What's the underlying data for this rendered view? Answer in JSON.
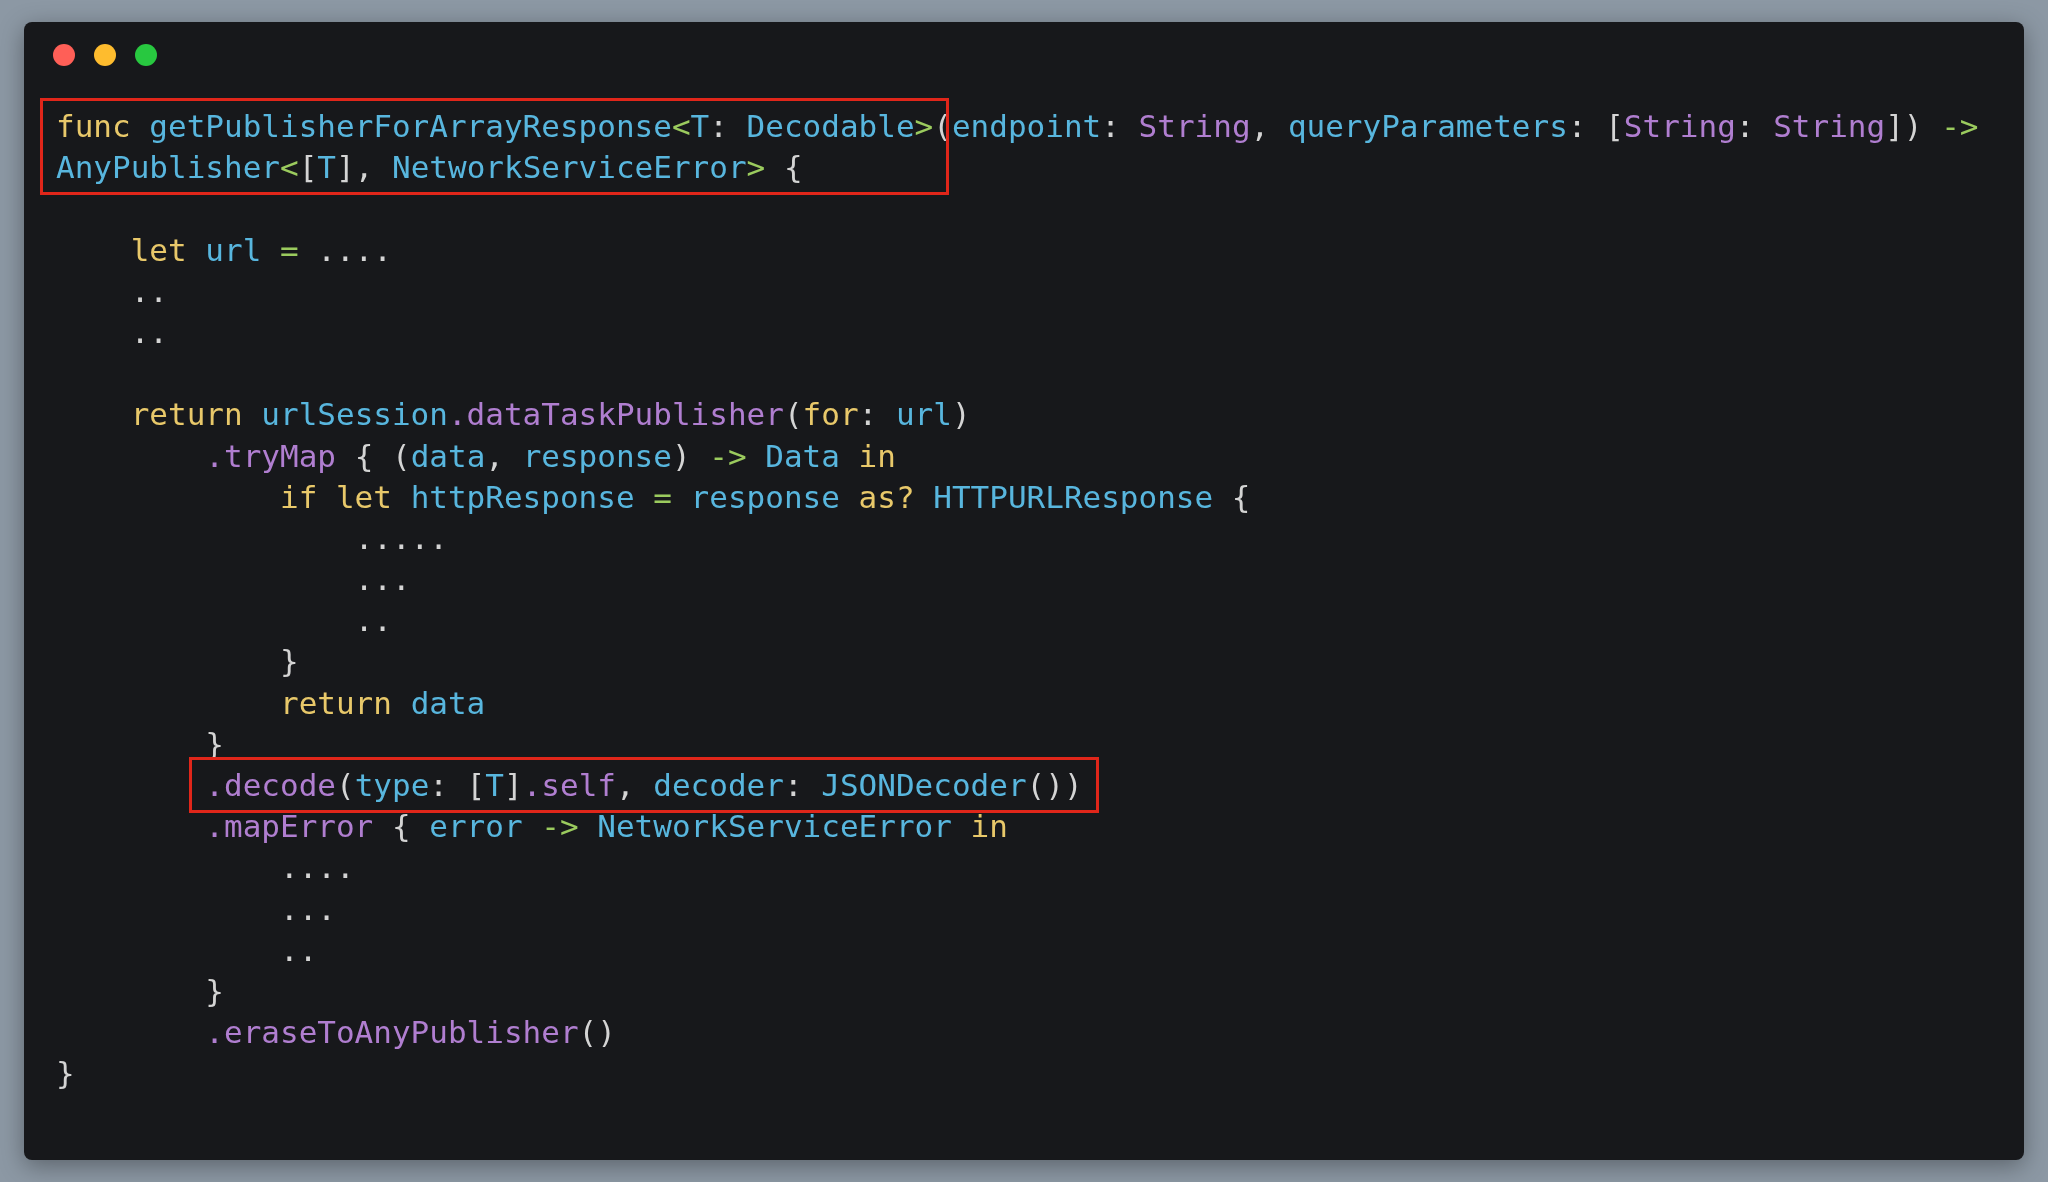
{
  "window": {
    "controls": [
      {
        "color": "#ff5f57"
      },
      {
        "color": "#febc2e"
      },
      {
        "color": "#28c840"
      }
    ]
  },
  "lines": [
    {
      "kind": "code",
      "segments": [
        {
          "highlighted": true,
          "tokens": [
            {
              "text": "func ",
              "kind": "keyword"
            },
            {
              "text": "getPublisherForArrayResponse",
              "kind": "identifier"
            },
            {
              "text": "<",
              "kind": "operator"
            },
            {
              "text": "T",
              "kind": "identifier"
            },
            {
              "text": ": ",
              "kind": "plain"
            },
            {
              "text": "Decodable",
              "kind": "identifier"
            },
            {
              "text": ">",
              "kind": "operator"
            }
          ]
        },
        {
          "highlighted": false,
          "tokens": [
            {
              "text": "(",
              "kind": "plain"
            },
            {
              "text": "endpoint",
              "kind": "identifier"
            },
            {
              "text": ": ",
              "kind": "plain"
            },
            {
              "text": "String",
              "kind": "type"
            },
            {
              "text": ", ",
              "kind": "plain"
            },
            {
              "text": "queryParameters",
              "kind": "identifier"
            },
            {
              "text": ": [",
              "kind": "plain"
            },
            {
              "text": "String",
              "kind": "type"
            },
            {
              "text": ": ",
              "kind": "plain"
            },
            {
              "text": "String",
              "kind": "type"
            },
            {
              "text": "]) ",
              "kind": "plain"
            },
            {
              "text": "->",
              "kind": "operator"
            }
          ]
        }
      ]
    },
    {
      "kind": "code",
      "segments": [
        {
          "highlighted": true,
          "tokens": [
            {
              "text": "AnyPublisher",
              "kind": "identifier"
            },
            {
              "text": "<",
              "kind": "operator"
            },
            {
              "text": "[",
              "kind": "plain"
            },
            {
              "text": "T",
              "kind": "identifier"
            },
            {
              "text": "], ",
              "kind": "plain"
            },
            {
              "text": "NetworkServiceError",
              "kind": "identifier"
            },
            {
              "text": ">",
              "kind": "operator"
            },
            {
              "text": " {",
              "kind": "plain"
            }
          ]
        }
      ]
    },
    {
      "kind": "blank"
    },
    {
      "kind": "code",
      "segments": [
        {
          "highlighted": false,
          "tokens": [
            {
              "text": "    let ",
              "kind": "keyword"
            },
            {
              "text": "url ",
              "kind": "identifier"
            },
            {
              "text": "= ",
              "kind": "operator"
            },
            {
              "text": "....",
              "kind": "plain"
            }
          ]
        }
      ]
    },
    {
      "kind": "code",
      "segments": [
        {
          "highlighted": false,
          "tokens": [
            {
              "text": "    ..",
              "kind": "plain"
            }
          ]
        }
      ]
    },
    {
      "kind": "code",
      "segments": [
        {
          "highlighted": false,
          "tokens": [
            {
              "text": "    ..",
              "kind": "plain"
            }
          ]
        }
      ]
    },
    {
      "kind": "blank"
    },
    {
      "kind": "code",
      "segments": [
        {
          "highlighted": false,
          "tokens": [
            {
              "text": "    return ",
              "kind": "keyword"
            },
            {
              "text": "urlSession",
              "kind": "identifier"
            },
            {
              "text": ".dataTaskPublisher",
              "kind": "type"
            },
            {
              "text": "(",
              "kind": "plain"
            },
            {
              "text": "for",
              "kind": "keyword"
            },
            {
              "text": ": ",
              "kind": "plain"
            },
            {
              "text": "url",
              "kind": "identifier"
            },
            {
              "text": ")",
              "kind": "plain"
            }
          ]
        }
      ]
    },
    {
      "kind": "code",
      "segments": [
        {
          "highlighted": false,
          "tokens": [
            {
              "text": "        .tryMap",
              "kind": "type"
            },
            {
              "text": " { (",
              "kind": "plain"
            },
            {
              "text": "data",
              "kind": "identifier"
            },
            {
              "text": ", ",
              "kind": "plain"
            },
            {
              "text": "response",
              "kind": "identifier"
            },
            {
              "text": ") ",
              "kind": "plain"
            },
            {
              "text": "-> ",
              "kind": "operator"
            },
            {
              "text": "Data ",
              "kind": "identifier"
            },
            {
              "text": "in",
              "kind": "keyword"
            }
          ]
        }
      ]
    },
    {
      "kind": "code",
      "segments": [
        {
          "highlighted": false,
          "tokens": [
            {
              "text": "            if let ",
              "kind": "keyword"
            },
            {
              "text": "httpResponse ",
              "kind": "identifier"
            },
            {
              "text": "= ",
              "kind": "operator"
            },
            {
              "text": "response ",
              "kind": "identifier"
            },
            {
              "text": "as? ",
              "kind": "keyword"
            },
            {
              "text": "HTTPURLResponse ",
              "kind": "identifier"
            },
            {
              "text": "{",
              "kind": "plain"
            }
          ]
        }
      ]
    },
    {
      "kind": "code",
      "segments": [
        {
          "highlighted": false,
          "tokens": [
            {
              "text": "                .....",
              "kind": "plain"
            }
          ]
        }
      ]
    },
    {
      "kind": "code",
      "segments": [
        {
          "highlighted": false,
          "tokens": [
            {
              "text": "                ...",
              "kind": "plain"
            }
          ]
        }
      ]
    },
    {
      "kind": "code",
      "segments": [
        {
          "highlighted": false,
          "tokens": [
            {
              "text": "                ..",
              "kind": "plain"
            }
          ]
        }
      ]
    },
    {
      "kind": "code",
      "segments": [
        {
          "highlighted": false,
          "tokens": [
            {
              "text": "            }",
              "kind": "plain"
            }
          ]
        }
      ]
    },
    {
      "kind": "code",
      "segments": [
        {
          "highlighted": false,
          "tokens": [
            {
              "text": "            return ",
              "kind": "keyword"
            },
            {
              "text": "data",
              "kind": "identifier"
            }
          ]
        }
      ]
    },
    {
      "kind": "code",
      "segments": [
        {
          "highlighted": false,
          "tokens": [
            {
              "text": "        }",
              "kind": "plain"
            }
          ]
        }
      ]
    },
    {
      "kind": "code",
      "segments": [
        {
          "highlighted": true,
          "tokens": [
            {
              "text": "        .decode",
              "kind": "type"
            },
            {
              "text": "(",
              "kind": "plain"
            },
            {
              "text": "type",
              "kind": "identifier"
            },
            {
              "text": ": [",
              "kind": "plain"
            },
            {
              "text": "T",
              "kind": "identifier"
            },
            {
              "text": "]",
              "kind": "plain"
            },
            {
              "text": ".self",
              "kind": "type"
            },
            {
              "text": ", ",
              "kind": "plain"
            },
            {
              "text": "decoder",
              "kind": "identifier"
            },
            {
              "text": ": ",
              "kind": "plain"
            },
            {
              "text": "JSONDecoder",
              "kind": "identifier"
            },
            {
              "text": "())",
              "kind": "plain"
            }
          ]
        }
      ]
    },
    {
      "kind": "code",
      "segments": [
        {
          "highlighted": false,
          "tokens": [
            {
              "text": "        .mapError",
              "kind": "type"
            },
            {
              "text": " { ",
              "kind": "plain"
            },
            {
              "text": "error ",
              "kind": "identifier"
            },
            {
              "text": "-> ",
              "kind": "operator"
            },
            {
              "text": "NetworkServiceError ",
              "kind": "identifier"
            },
            {
              "text": "in",
              "kind": "keyword"
            }
          ]
        }
      ]
    },
    {
      "kind": "code",
      "segments": [
        {
          "highlighted": false,
          "tokens": [
            {
              "text": "            ....",
              "kind": "plain"
            }
          ]
        }
      ]
    },
    {
      "kind": "code",
      "segments": [
        {
          "highlighted": false,
          "tokens": [
            {
              "text": "            ...",
              "kind": "plain"
            }
          ]
        }
      ]
    },
    {
      "kind": "code",
      "segments": [
        {
          "highlighted": false,
          "tokens": [
            {
              "text": "            ..",
              "kind": "plain"
            }
          ]
        }
      ]
    },
    {
      "kind": "code",
      "segments": [
        {
          "highlighted": false,
          "tokens": [
            {
              "text": "        }",
              "kind": "plain"
            }
          ]
        }
      ]
    },
    {
      "kind": "code",
      "segments": [
        {
          "highlighted": false,
          "tokens": [
            {
              "text": "        .eraseToAnyPublisher",
              "kind": "type"
            },
            {
              "text": "()",
              "kind": "plain"
            }
          ]
        }
      ]
    },
    {
      "kind": "code",
      "segments": [
        {
          "highlighted": false,
          "tokens": [
            {
              "text": "}",
              "kind": "plain"
            }
          ]
        }
      ]
    }
  ]
}
